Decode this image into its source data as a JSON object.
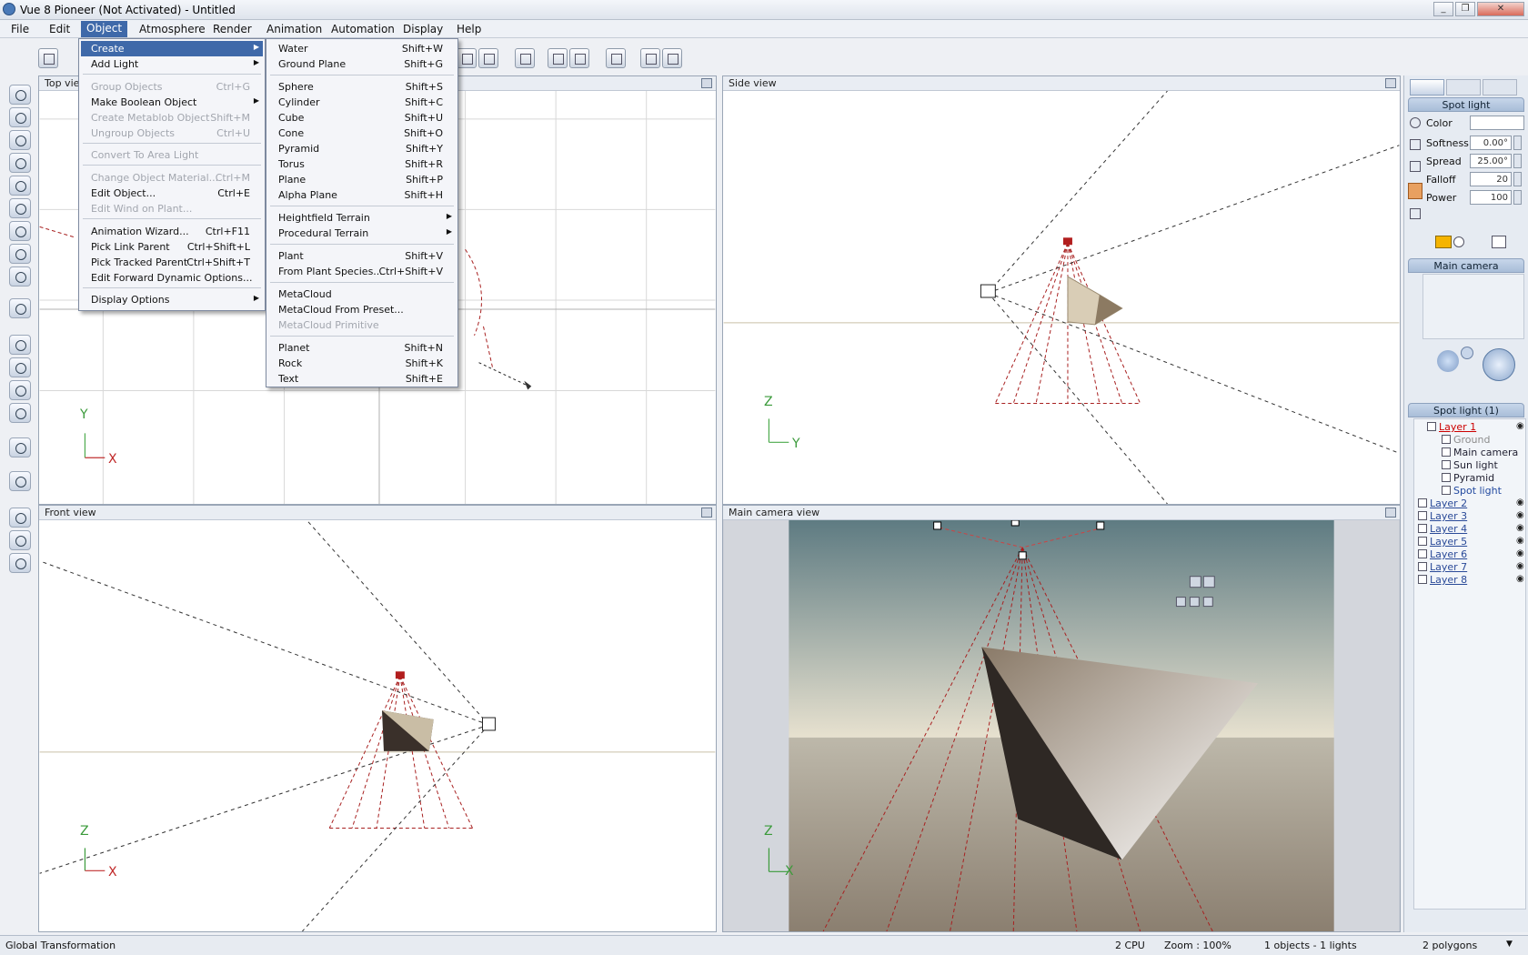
{
  "window": {
    "title": "Vue 8 Pioneer (Not Activated) - Untitled"
  },
  "menubar": [
    "File",
    "Edit",
    "Object",
    "Atmosphere",
    "Render",
    "Animation",
    "Automation",
    "Display",
    "Help"
  ],
  "object_menu": [
    {
      "label": "Create",
      "shortcut": "",
      "arrow": true,
      "highlight": true
    },
    {
      "label": "Add Light",
      "shortcut": "",
      "arrow": true
    },
    {
      "sep": true
    },
    {
      "label": "Group Objects",
      "shortcut": "Ctrl+G",
      "disabled": true
    },
    {
      "label": "Make Boolean Object",
      "shortcut": "",
      "arrow": true
    },
    {
      "label": "Create Metablob Object",
      "shortcut": "Shift+M",
      "disabled": true
    },
    {
      "label": "Ungroup Objects",
      "shortcut": "Ctrl+U",
      "disabled": true
    },
    {
      "sep": true
    },
    {
      "label": "Convert To Area Light",
      "shortcut": "",
      "disabled": true
    },
    {
      "sep": true
    },
    {
      "label": "Change Object Material...",
      "shortcut": "Ctrl+M",
      "disabled": true
    },
    {
      "label": "Edit Object...",
      "shortcut": "Ctrl+E"
    },
    {
      "label": "Edit Wind on Plant...",
      "shortcut": "",
      "disabled": true
    },
    {
      "sep": true
    },
    {
      "label": "Animation Wizard...",
      "shortcut": "Ctrl+F11"
    },
    {
      "label": "Pick Link Parent",
      "shortcut": "Ctrl+Shift+L"
    },
    {
      "label": "Pick Tracked Parent",
      "shortcut": "Ctrl+Shift+T"
    },
    {
      "label": "Edit Forward Dynamic Options...",
      "shortcut": ""
    },
    {
      "sep": true
    },
    {
      "label": "Display Options",
      "shortcut": "",
      "arrow": true
    }
  ],
  "create_menu": [
    {
      "label": "Water",
      "shortcut": "Shift+W"
    },
    {
      "label": "Ground Plane",
      "shortcut": "Shift+G"
    },
    {
      "sep": true
    },
    {
      "label": "Sphere",
      "shortcut": "Shift+S"
    },
    {
      "label": "Cylinder",
      "shortcut": "Shift+C"
    },
    {
      "label": "Cube",
      "shortcut": "Shift+U"
    },
    {
      "label": "Cone",
      "shortcut": "Shift+O"
    },
    {
      "label": "Pyramid",
      "shortcut": "Shift+Y"
    },
    {
      "label": "Torus",
      "shortcut": "Shift+R"
    },
    {
      "label": "Plane",
      "shortcut": "Shift+P"
    },
    {
      "label": "Alpha Plane",
      "shortcut": "Shift+H"
    },
    {
      "sep": true
    },
    {
      "label": "Heightfield Terrain",
      "shortcut": "",
      "arrow": true
    },
    {
      "label": "Procedural Terrain",
      "shortcut": "",
      "arrow": true
    },
    {
      "sep": true
    },
    {
      "label": "Plant",
      "shortcut": "Shift+V"
    },
    {
      "label": "From Plant Species...",
      "shortcut": "Ctrl+Shift+V"
    },
    {
      "sep": true
    },
    {
      "label": "MetaCloud",
      "shortcut": ""
    },
    {
      "label": "MetaCloud From Preset...",
      "shortcut": ""
    },
    {
      "label": "MetaCloud Primitive",
      "shortcut": "",
      "disabled": true
    },
    {
      "sep": true
    },
    {
      "label": "Planet",
      "shortcut": "Shift+N"
    },
    {
      "label": "Rock",
      "shortcut": "Shift+K"
    },
    {
      "label": "Text",
      "shortcut": "Shift+E"
    }
  ],
  "viewports": {
    "top": {
      "title": "Top view",
      "axis_v": "Y",
      "axis_h": "X"
    },
    "side": {
      "title": "Side view",
      "axis_v": "Z",
      "axis_h": "Y"
    },
    "front": {
      "title": "Front view",
      "axis_v": "Z",
      "axis_h": "X"
    },
    "camera": {
      "title": "Main camera view",
      "axis_v": "Z",
      "axis_h": "X"
    }
  },
  "light_panel": {
    "title": "Spot light",
    "props": [
      {
        "label": "Color",
        "value": ""
      },
      {
        "label": "Softness",
        "value": "0.00°"
      },
      {
        "label": "Spread",
        "value": "25.00°"
      },
      {
        "label": "Falloff",
        "value": "20"
      },
      {
        "label": "Power",
        "value": "100"
      }
    ],
    "light_color": "#f5b400"
  },
  "camera_panel": {
    "title": "Main camera"
  },
  "layers_panel": {
    "title": "Spot light (1)",
    "tree": [
      {
        "label": "Layer 1",
        "kind": "layer1"
      },
      {
        "label": "Ground",
        "kind": "child dim"
      },
      {
        "label": "Main camera",
        "kind": "child"
      },
      {
        "label": "Sun light",
        "kind": "child"
      },
      {
        "label": "Pyramid",
        "kind": "child"
      },
      {
        "label": "Spot light",
        "kind": "child sel"
      },
      {
        "label": "Layer 2",
        "kind": "layer"
      },
      {
        "label": "Layer 3",
        "kind": "layer"
      },
      {
        "label": "Layer 4",
        "kind": "layer"
      },
      {
        "label": "Layer 5",
        "kind": "layer"
      },
      {
        "label": "Layer 6",
        "kind": "layer"
      },
      {
        "label": "Layer 7",
        "kind": "layer"
      },
      {
        "label": "Layer 8",
        "kind": "layer"
      }
    ]
  },
  "statusbar": {
    "mode": "Global Transformation",
    "cpu": "2 CPU",
    "zoom": "Zoom : 100%",
    "objects": "1 objects - 1 lights",
    "polygons": "2 polygons"
  }
}
